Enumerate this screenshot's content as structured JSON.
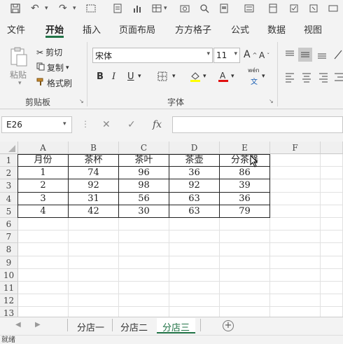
{
  "ribbon_tabs": [
    "文件",
    "开始",
    "插入",
    "页面布局",
    "方方格子",
    "公式",
    "数据",
    "视图"
  ],
  "active_tab": "开始",
  "clipboard": {
    "paste": "粘贴",
    "cut": "剪切",
    "copy": "复制",
    "format_painter": "格式刷",
    "group_label": "剪贴板"
  },
  "font": {
    "name": "宋体",
    "size": "11",
    "group_label": "字体",
    "bold": "B",
    "italic": "I",
    "underline": "U",
    "wen": "wén",
    "wen_char": "文"
  },
  "name_box": "E26",
  "formula_value": "",
  "columns": [
    "A",
    "B",
    "C",
    "D",
    "E",
    "F"
  ],
  "rows": [
    "1",
    "2",
    "3",
    "4",
    "5",
    "6",
    "7",
    "8",
    "9",
    "10",
    "11",
    "12",
    "13"
  ],
  "table": {
    "header": [
      "月份",
      "茶杯",
      "茶叶",
      "茶壶",
      "分茶器"
    ],
    "data": [
      [
        "1",
        "74",
        "96",
        "36",
        "86"
      ],
      [
        "2",
        "92",
        "98",
        "92",
        "39"
      ],
      [
        "3",
        "31",
        "56",
        "63",
        "36"
      ],
      [
        "4",
        "42",
        "30",
        "63",
        "79"
      ]
    ]
  },
  "sheets": [
    "分店一",
    "分店二",
    "分店三"
  ],
  "active_sheet": "分店三",
  "status_text": "就绪",
  "colors": {
    "accent": "#217346",
    "chrome": "#f3f3f3"
  }
}
